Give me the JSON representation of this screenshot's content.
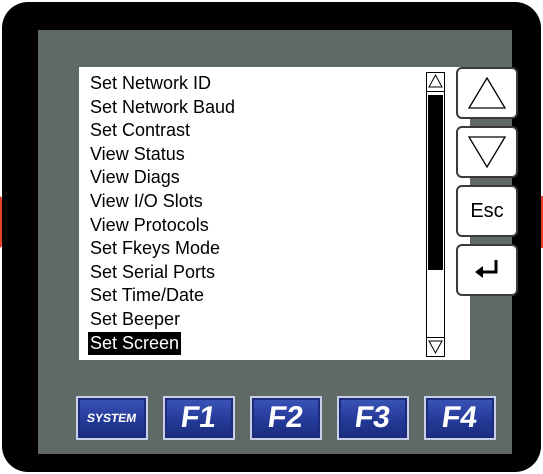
{
  "menu": {
    "items": [
      {
        "label": "Set Network ID",
        "selected": false
      },
      {
        "label": "Set Network Baud",
        "selected": false
      },
      {
        "label": "Set Contrast",
        "selected": false
      },
      {
        "label": "View Status",
        "selected": false
      },
      {
        "label": "View Diags",
        "selected": false
      },
      {
        "label": "View I/O Slots",
        "selected": false
      },
      {
        "label": "View Protocols",
        "selected": false
      },
      {
        "label": "Set Fkeys Mode",
        "selected": false
      },
      {
        "label": "Set Serial Ports",
        "selected": false
      },
      {
        "label": "Set Time/Date",
        "selected": false
      },
      {
        "label": "Set Beeper",
        "selected": false
      },
      {
        "label": "Set Screen",
        "selected": true
      }
    ]
  },
  "side_buttons": {
    "up_icon": "up-triangle-icon",
    "down_icon": "down-triangle-icon",
    "esc_label": "Esc",
    "enter_icon": "enter-arrow-icon"
  },
  "function_keys": [
    {
      "label": "SYSTEM"
    },
    {
      "label": "F1"
    },
    {
      "label": "F2"
    },
    {
      "label": "F3"
    },
    {
      "label": "F4"
    }
  ],
  "colors": {
    "bezel": "#000000",
    "faceplate": "#5f6a67",
    "fkey_blue": "#243a99",
    "indicator_red": "#e8412c"
  }
}
